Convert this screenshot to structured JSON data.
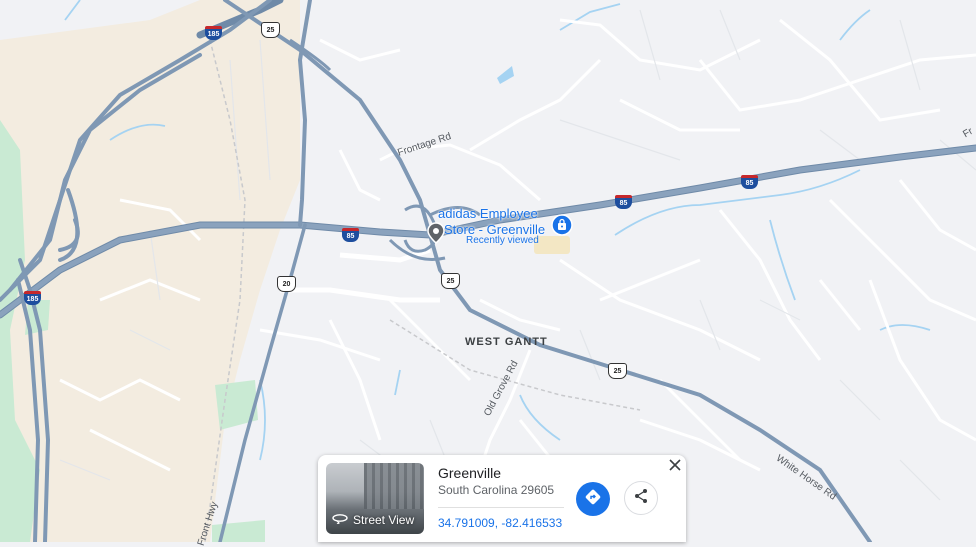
{
  "map": {
    "colors": {
      "background": "#f1f2f5",
      "city_area": "#f3ece0",
      "park": "#c9ead3",
      "water": "#a5d3f2",
      "highway": "#7f98b4",
      "road": "#ffffff",
      "poi_accent": "#1a73e8"
    },
    "road_labels": {
      "frontage": "Frontage Rd",
      "old_grove": "Old Grove Rd",
      "white_horse": "White Horse Rd",
      "front_hwy": "Front Hwy",
      "fr_edge": "Fr"
    },
    "area_label": "WEST GANTT",
    "shields": {
      "us25_a": "25",
      "us25_b": "25",
      "us25_c": "25",
      "us20": "20",
      "i185_a": "185",
      "i185_b": "185",
      "i85_a": "85",
      "i85_b": "85",
      "i85_c": "85"
    },
    "poi": {
      "name_line1": "adidas Employee",
      "name_line2": "Store - Greenville",
      "sub": "Recently viewed",
      "pin_icon": "map-pin-icon",
      "store_icon": "shopping-bag-icon"
    }
  },
  "card": {
    "title": "Greenville",
    "subtitle": "South Carolina 29605",
    "coords": "34.791009, -82.416533",
    "street_view_label": "Street View",
    "icons": {
      "street_view": "360-view-icon",
      "directions": "directions-icon",
      "share": "share-icon",
      "close": "close-icon"
    }
  }
}
